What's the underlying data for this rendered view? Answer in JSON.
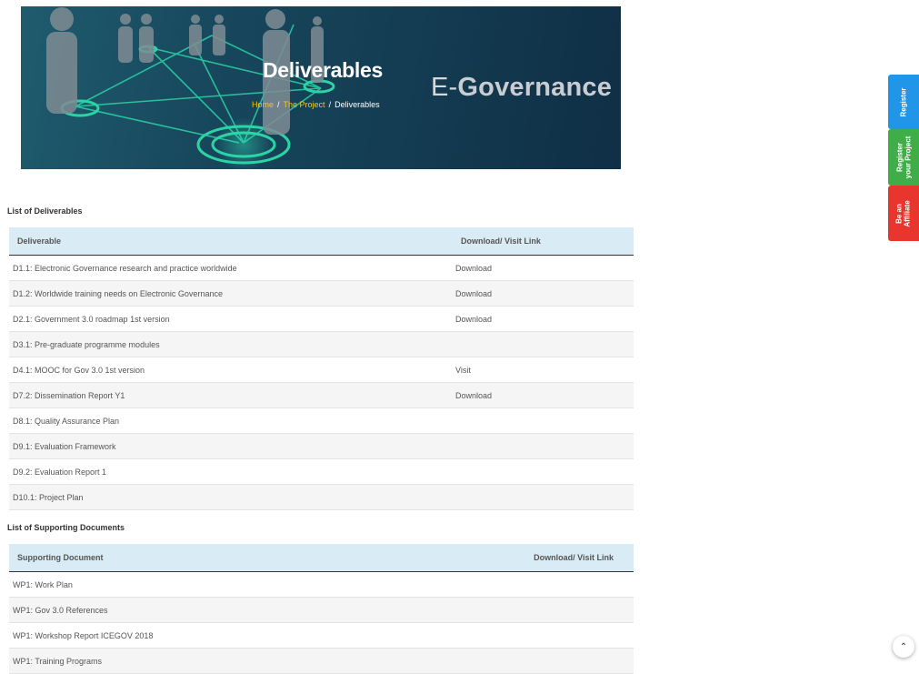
{
  "banner": {
    "title": "Deliverables",
    "breadcrumb": [
      "Home",
      "The Project",
      "Deliverables"
    ],
    "separator": "/",
    "brand_prefix": "E-",
    "brand_word": "Governance"
  },
  "deliverables": {
    "heading": "List of Deliverables",
    "columns": [
      "Deliverable",
      "Download/ Visit Link"
    ],
    "rows": [
      {
        "name": "D1.1: Electronic Governance research and practice worldwide",
        "link": "Download"
      },
      {
        "name": "D1.2: Worldwide training needs on Electronic Governance",
        "link": "Download"
      },
      {
        "name": "D2.1: Government 3.0 roadmap 1st version",
        "link": "Download"
      },
      {
        "name": "D3.1: Pre-graduate programme modules",
        "link": ""
      },
      {
        "name": "D4.1: MOOC for Gov 3.0 1st version",
        "link": "Visit"
      },
      {
        "name": "D7.2: Dissemination Report Y1",
        "link": "Download"
      },
      {
        "name": "D8.1: Quality Assurance Plan",
        "link": ""
      },
      {
        "name": "D9.1: Evaluation Framework",
        "link": ""
      },
      {
        "name": "D9.2: Evaluation Report 1",
        "link": ""
      },
      {
        "name": "D10.1: Project Plan",
        "link": ""
      }
    ]
  },
  "supporting": {
    "heading": "List of Supporting Documents",
    "columns": [
      "Supporting Document",
      "Download/ Visit Link"
    ],
    "rows": [
      {
        "name": "WP1: Work Plan",
        "link": ""
      },
      {
        "name": "WP1: Gov 3.0 References",
        "link": ""
      },
      {
        "name": "WP1: Workshop Report ICEGOV 2018",
        "link": ""
      },
      {
        "name": "WP1: Training Programs",
        "link": ""
      }
    ]
  },
  "side_tabs": {
    "register": "Register",
    "register_project": [
      "Register",
      "your Project"
    ],
    "affiliate": [
      "Be an",
      "Affiliate"
    ]
  },
  "scroll_top": {
    "icon": "chevron-up-icon",
    "glyph": "⌃"
  },
  "colors": {
    "table_header": "#d9ecf5",
    "register": "#2196e8",
    "project": "#3fae49",
    "affiliate": "#e8352d",
    "breadcrumb_link": "#f5c518"
  }
}
